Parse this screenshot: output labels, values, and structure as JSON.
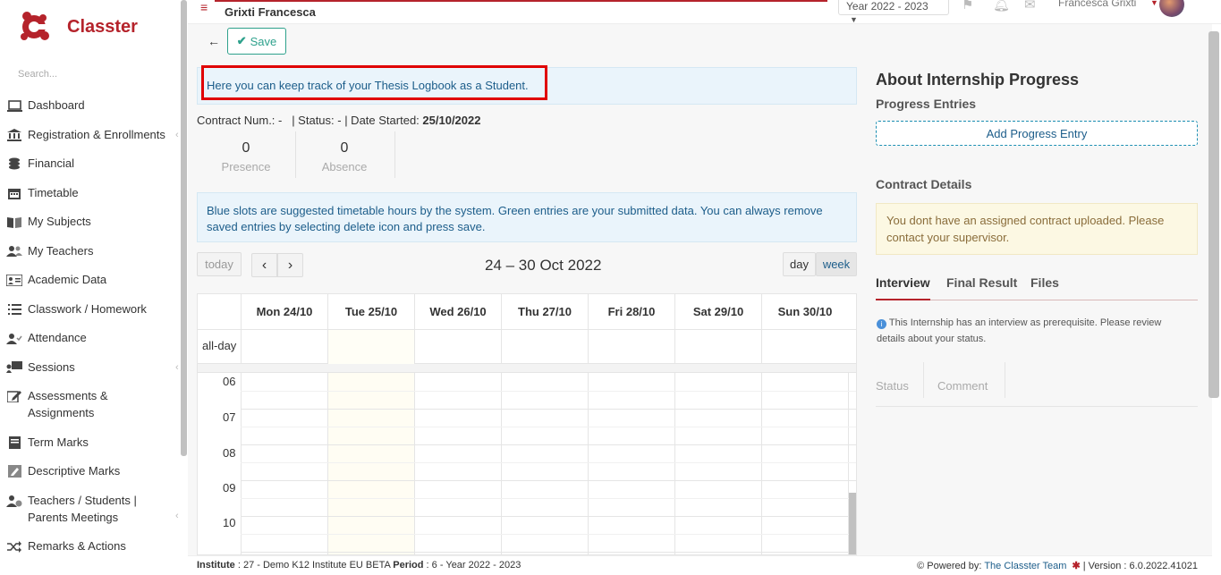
{
  "app": {
    "name": "Classter",
    "search_placeholder": "Search..."
  },
  "sidebar": {
    "items": [
      {
        "label": "Dashboard",
        "icon": "laptop-icon"
      },
      {
        "label": "Registration & Enrollments",
        "icon": "bank-icon"
      },
      {
        "label": "Financial",
        "icon": "coins-icon"
      },
      {
        "label": "Timetable",
        "icon": "calendar-icon"
      },
      {
        "label": "My Subjects",
        "icon": "book-icon"
      },
      {
        "label": "My Teachers",
        "icon": "users-icon"
      },
      {
        "label": "Academic Data",
        "icon": "id-card-icon"
      },
      {
        "label": "Classwork / Homework",
        "icon": "list-icon"
      },
      {
        "label": "Attendance",
        "icon": "user-check-icon"
      },
      {
        "label": "Sessions",
        "icon": "presentation-icon"
      },
      {
        "label": "Assessments & Assignments",
        "icon": "edit-icon"
      },
      {
        "label": "Term Marks",
        "icon": "book-marks-icon"
      },
      {
        "label": "Descriptive Marks",
        "icon": "pencil-icon"
      },
      {
        "label": "Teachers / Students | Parents Meetings",
        "icon": "meeting-icon"
      },
      {
        "label": "Remarks & Actions",
        "icon": "shuffle-icon"
      }
    ]
  },
  "topbar": {
    "student_name": "Grixti Francesca",
    "year": "Year 2022 - 2023",
    "user_name": "Francesca Grixti"
  },
  "toolbar": {
    "save_label": "Save"
  },
  "main": {
    "info_text": "Here you can keep track of your Thesis Logbook as a Student.",
    "contract_prefix": "Contract Num.: -   | Status: - | Date Started: ",
    "date_started": "25/10/2022",
    "stats": [
      {
        "value": "0",
        "label": "Presence"
      },
      {
        "value": "0",
        "label": "Absence"
      }
    ],
    "hint_text": "Blue slots are suggested timetable hours by the system. Green entries are your submitted data. You can always remove saved entries by selecting delete icon and press save."
  },
  "calendar": {
    "today_label": "today",
    "prev_label": "‹",
    "next_label": "›",
    "range_title": "24 – 30 Oct 2022",
    "day_label": "day",
    "week_label": "week",
    "allday_label": "all-day",
    "days": [
      "Mon 24/10",
      "Tue 25/10",
      "Wed 26/10",
      "Thu 27/10",
      "Fri 28/10",
      "Sat 29/10",
      "Sun 30/10"
    ],
    "hours": [
      "06",
      "07",
      "08",
      "09",
      "10"
    ]
  },
  "right_panel": {
    "title": "About Internship Progress",
    "progress_heading": "Progress Entries",
    "add_entry_label": "Add Progress Entry",
    "contract_heading": "Contract Details",
    "contract_warning": "You dont have an assigned contract uploaded. Please contact your supervisor.",
    "tabs": [
      "Interview",
      "Final Result",
      "Files"
    ],
    "interview_note": "This Internship has an interview as prerequisite. Please review details about your status.",
    "interview_cols": [
      "Status",
      "Comment"
    ]
  },
  "footer": {
    "institute_label": "Institute",
    "institute_value": " : 27 - Demo K12 Institute EU BETA ",
    "period_label": "Period",
    "period_value": " : 6 - Year 2022 - 2023",
    "powered_by": "Powered by: ",
    "team_link": "The Classter Team",
    "version": " | Version : 6.0.2022.41021"
  },
  "colors": {
    "brand": "#b5232b",
    "accent": "#2ea18c",
    "link": "#1c5d8a"
  }
}
